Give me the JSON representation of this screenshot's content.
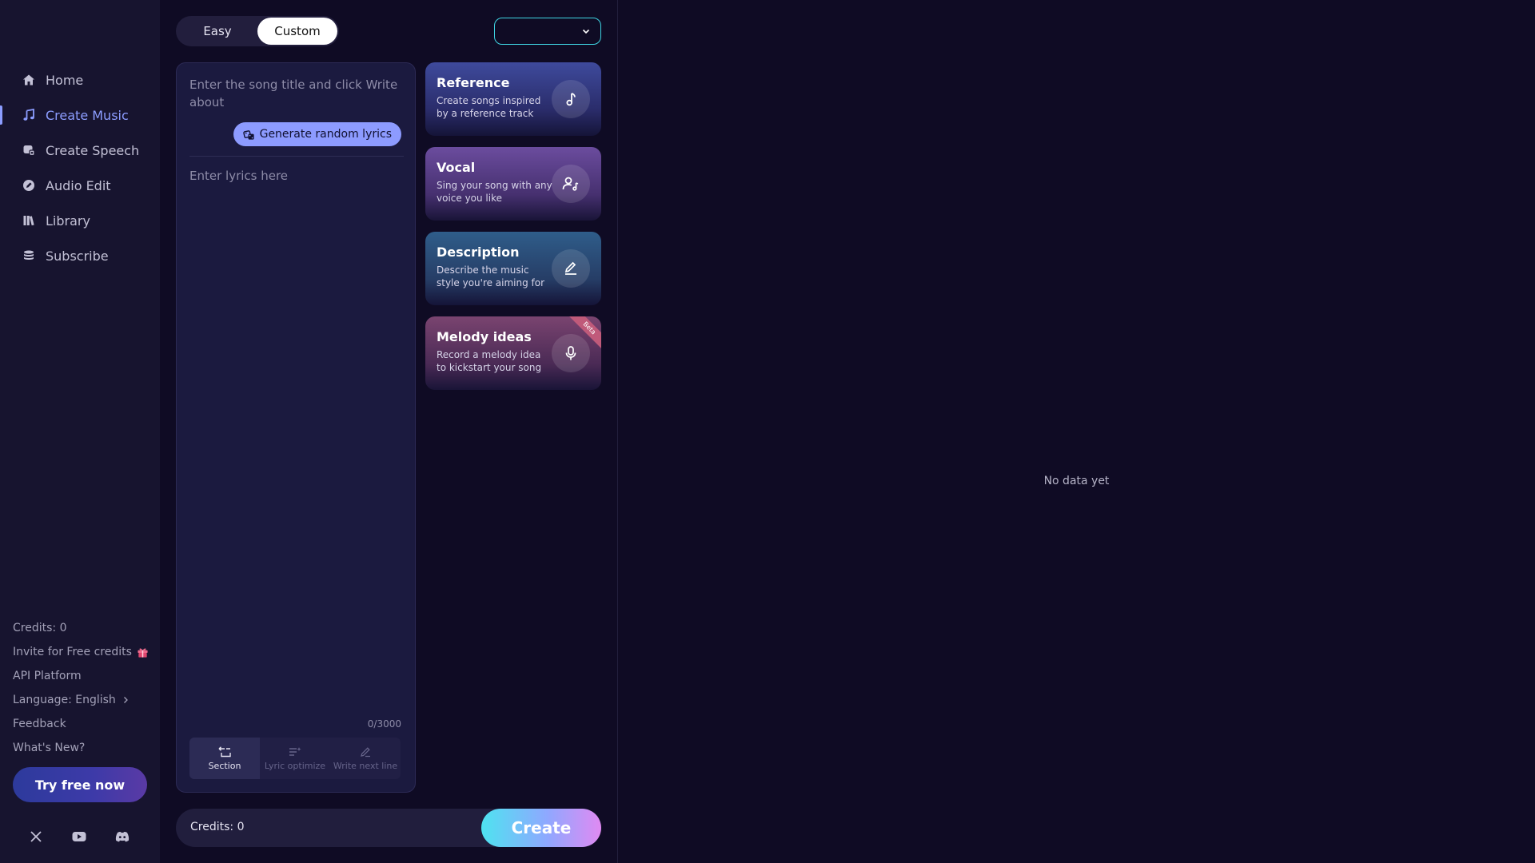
{
  "nav": {
    "items": [
      {
        "label": "Home",
        "icon": "home-icon"
      },
      {
        "label": "Create Music",
        "icon": "music-note-icon",
        "active": true
      },
      {
        "label": "Create Speech",
        "icon": "speech-icon"
      },
      {
        "label": "Audio Edit",
        "icon": "edit-icon"
      },
      {
        "label": "Library",
        "icon": "library-icon"
      },
      {
        "label": "Subscribe",
        "icon": "coins-icon"
      }
    ]
  },
  "sidebar": {
    "credits": "Credits: 0",
    "invite": "Invite for Free credits",
    "api": "API Platform",
    "language": "Language: English",
    "feedback": "Feedback",
    "whats_new": "What's New?",
    "try_free": "Try free now",
    "socials": [
      "x-icon",
      "youtube-icon",
      "discord-icon"
    ]
  },
  "mode": {
    "easy": "Easy",
    "custom": "Custom",
    "selected": "Custom"
  },
  "model_select": {
    "value": ""
  },
  "lyrics": {
    "title_placeholder": "Enter the song title and click Write about",
    "generate_label": "Generate random lyrics",
    "lyrics_placeholder": "Enter lyrics here",
    "counter": "0/3000",
    "tools": [
      {
        "label": "Section",
        "active": true
      },
      {
        "label": "Lyric optimize",
        "active": false
      },
      {
        "label": "Write next line",
        "active": false
      }
    ]
  },
  "cards": [
    {
      "title": "Reference",
      "desc": "Create songs inspired by a reference track",
      "icon": "music-note-icon"
    },
    {
      "title": "Vocal",
      "desc": "Sing your song with any voice you like",
      "icon": "voice-icon"
    },
    {
      "title": "Description",
      "desc": "Describe the music style you're aiming for",
      "icon": "pen-icon"
    },
    {
      "title": "Melody ideas",
      "desc": "Record a melody idea to kickstart your song",
      "icon": "microphone-icon",
      "badge": "Beta"
    }
  ],
  "bottom": {
    "credits": "Credits: 0",
    "create": "Create"
  },
  "result": {
    "empty": "No data yet"
  },
  "colors": {
    "accent": "#8c9dff",
    "background": "#0f0b24",
    "sidebar": "#17142f",
    "select_border": "#3fd5e3"
  }
}
